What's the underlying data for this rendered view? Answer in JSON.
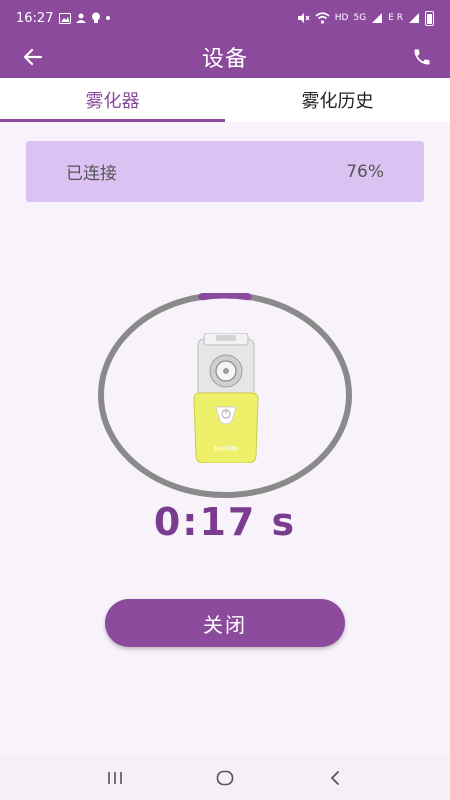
{
  "status_bar": {
    "time": "16:27",
    "left_icons": [
      "image-icon",
      "face-icon",
      "lightbulb-icon",
      "dot-icon"
    ],
    "right_icons": [
      "mute-icon",
      "wifi-icon",
      "signal-icon",
      "signal-icon",
      "battery-icon"
    ],
    "hd": "HD",
    "net1": "5G",
    "net2": "E R"
  },
  "app_bar": {
    "title": "设备",
    "back_icon": "arrow-left-icon",
    "action_icon": "phone-icon"
  },
  "tabs": [
    {
      "label": "雾化器",
      "active": true
    },
    {
      "label": "雾化历史",
      "active": false
    }
  ],
  "device_status": {
    "connection": "已连接",
    "battery": "76%"
  },
  "timer": {
    "display": "0:17 s",
    "progress": 0.06
  },
  "device_image": {
    "brand_text": "feellife"
  },
  "actions": {
    "close_label": "关闭"
  },
  "colors": {
    "primary": "#8b4a9c",
    "card": "#dcc2f3",
    "ring": "#8a8a8a",
    "ring_progress": "#8b4a9c",
    "device_body": "#eef06a"
  },
  "nav_bar": {
    "recent_icon": "recent-apps-icon",
    "home_icon": "home-icon",
    "back_icon": "back-icon"
  }
}
